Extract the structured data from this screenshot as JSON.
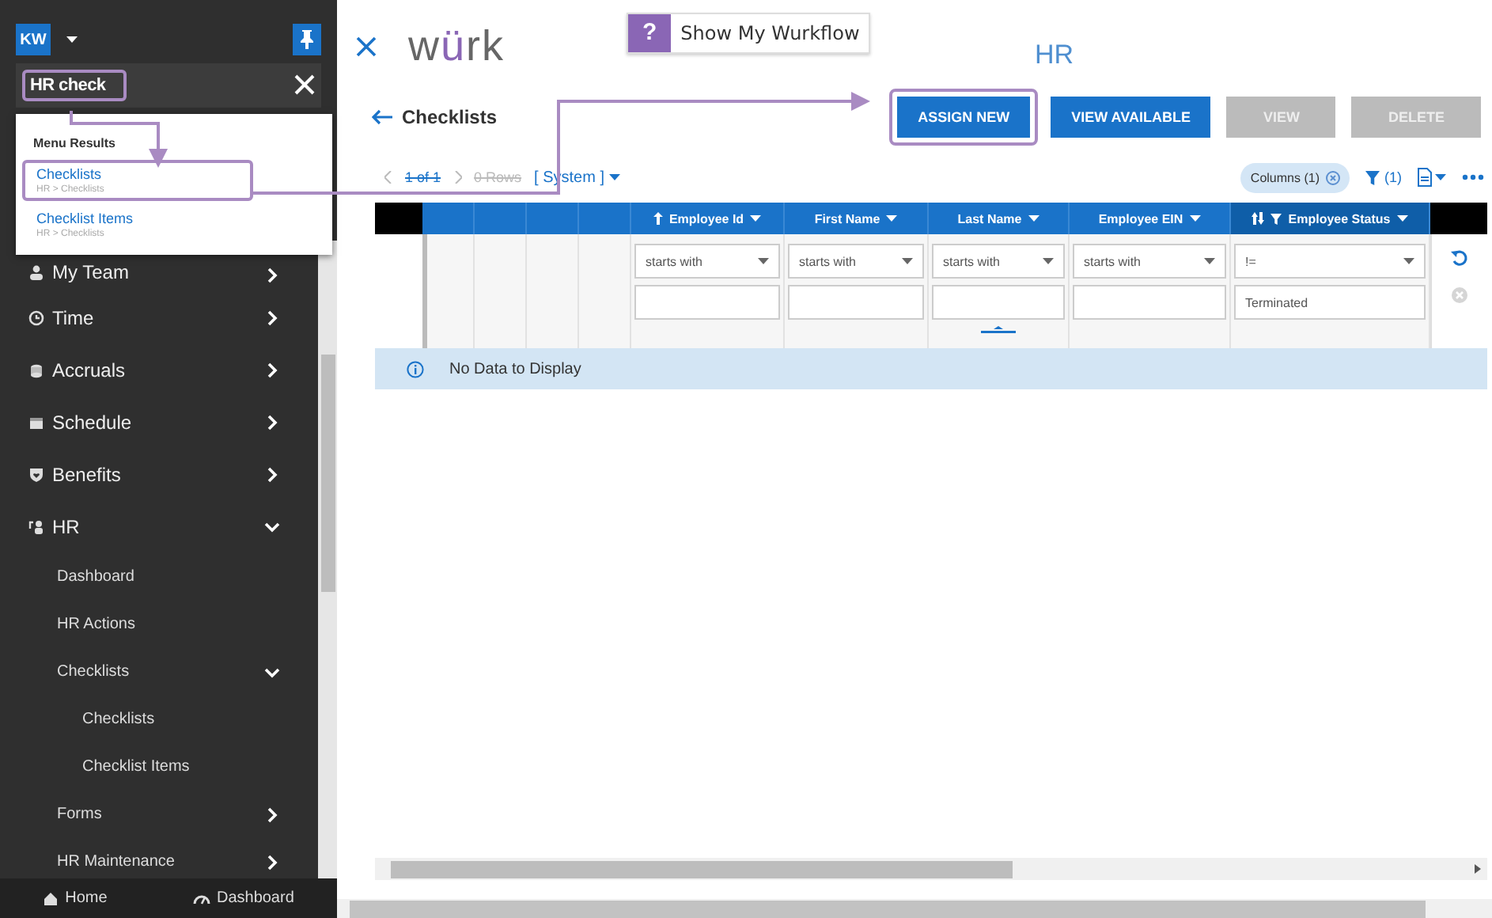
{
  "sidebar": {
    "user_initials": "KW",
    "search": {
      "value": "HR check"
    },
    "search_results": {
      "heading": "Menu Results",
      "items": [
        {
          "label": "Checklists",
          "path": "HR > Checklists",
          "selected": true
        },
        {
          "label": "Checklist Items",
          "path": "HR > Checklists",
          "selected": false
        }
      ]
    },
    "nav": [
      {
        "label": "My Team",
        "kind": "group",
        "expanded": false
      },
      {
        "label": "Time",
        "kind": "group",
        "expanded": false
      },
      {
        "label": "Accruals",
        "kind": "group",
        "expanded": false
      },
      {
        "label": "Schedule",
        "kind": "group",
        "expanded": false
      },
      {
        "label": "Benefits",
        "kind": "group",
        "expanded": false
      },
      {
        "label": "HR",
        "kind": "group",
        "expanded": true,
        "children": [
          {
            "label": "Dashboard",
            "kind": "link"
          },
          {
            "label": "HR Actions",
            "kind": "link"
          },
          {
            "label": "Checklists",
            "kind": "group",
            "expanded": true,
            "children": [
              {
                "label": "Checklists",
                "kind": "link"
              },
              {
                "label": "Checklist Items",
                "kind": "link"
              }
            ]
          },
          {
            "label": "Forms",
            "kind": "group",
            "expanded": false
          },
          {
            "label": "HR Maintenance",
            "kind": "group",
            "expanded": false
          }
        ]
      }
    ],
    "footer": [
      {
        "label": "Home"
      },
      {
        "label": "Dashboard"
      }
    ]
  },
  "header": {
    "logo": [
      {
        "text": "w",
        "accent": false
      },
      {
        "text": "ü",
        "accent": true
      },
      {
        "text": "rk",
        "accent": false
      }
    ],
    "help": {
      "icon": "?",
      "label": "Show My Wurkflow"
    },
    "module_title": "HR"
  },
  "page": {
    "title": "Checklists",
    "buttons": [
      {
        "label": "ASSIGN NEW",
        "disabled": false
      },
      {
        "label": "VIEW AVAILABLE",
        "disabled": false
      },
      {
        "label": "VIEW",
        "disabled": true
      },
      {
        "label": "DELETE",
        "disabled": true
      }
    ]
  },
  "toolbar": {
    "pager": "1 of 1",
    "rows": "0 Rows",
    "view": "[ System ]",
    "columns_chip": "Columns (1)",
    "filter_count": "(1)"
  },
  "table": {
    "columns": [
      {
        "label": "Employee Id",
        "kind": "sorted",
        "selected": false
      },
      {
        "label": "First Name",
        "kind": "plain",
        "selected": false
      },
      {
        "label": "Last Name",
        "kind": "plain",
        "selected": false
      },
      {
        "label": "Employee EIN",
        "kind": "plain",
        "selected": false
      },
      {
        "label": "Employee Status",
        "kind": "filtered",
        "selected": true
      }
    ],
    "filters": [
      {
        "operator": "starts with"
      },
      {
        "operator": "starts with"
      },
      {
        "operator": "starts with"
      },
      {
        "operator": "starts with"
      },
      {
        "operator": "!=",
        "value": "Terminated"
      }
    ],
    "empty_message": "No Data to Display"
  }
}
